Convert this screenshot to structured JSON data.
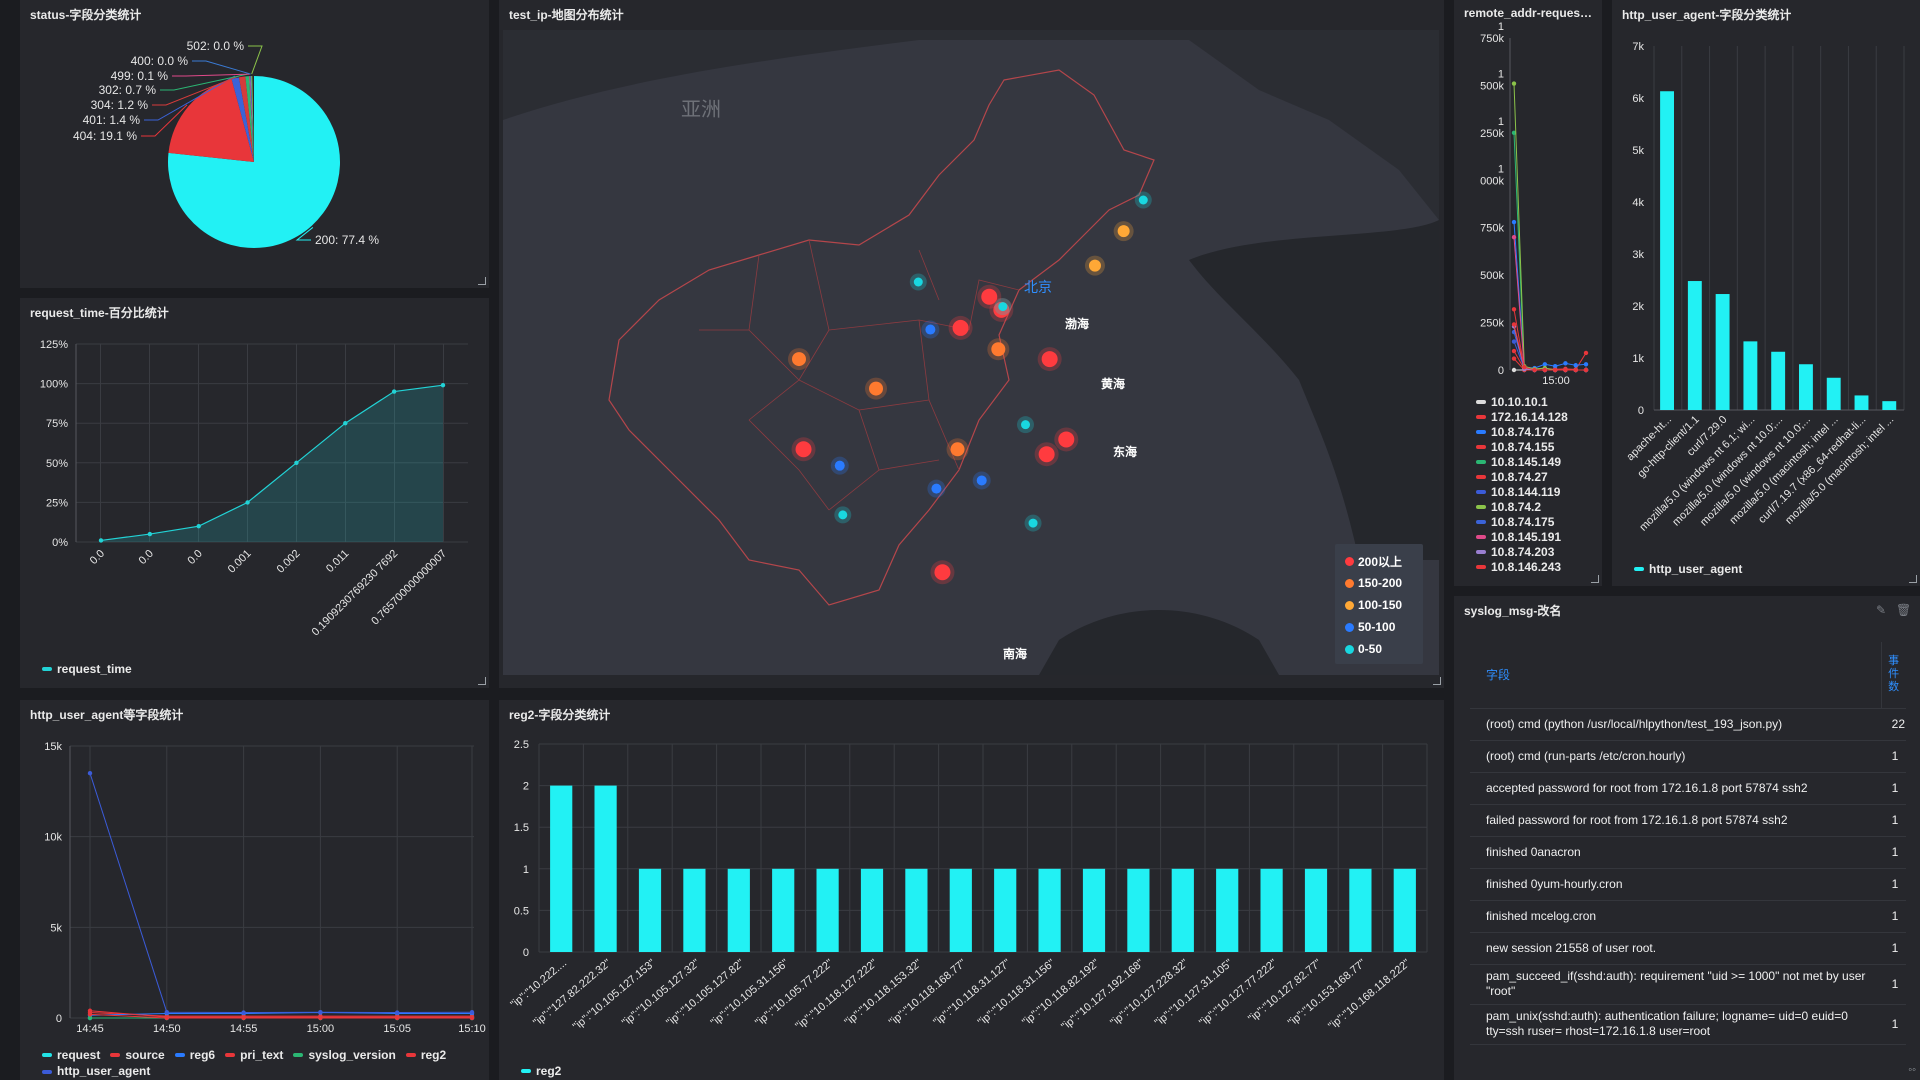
{
  "panels": {
    "status": {
      "title": "status-字段分类统计"
    },
    "request_time": {
      "title": "request_time-百分比统计"
    },
    "map": {
      "title": "test_ip-地图分布统计"
    },
    "remote": {
      "title": "remote_addr-request_l..."
    },
    "agent_bar": {
      "title": "http_user_agent-字段分类统计"
    },
    "multi": {
      "title": "http_user_agent等字段统计"
    },
    "reg2": {
      "title": "reg2-字段分类统计"
    },
    "syslog": {
      "title": "syslog_msg-改名"
    }
  },
  "status_pie": {
    "chart_data": {
      "type": "pie",
      "slices": [
        {
          "label": "200",
          "value": 77.4,
          "text": "200: 77.4 %",
          "color": "#22f1f4"
        },
        {
          "label": "404",
          "value": 19.1,
          "text": "404: 19.1 %",
          "color": "#e8363a"
        },
        {
          "label": "401",
          "value": 1.4,
          "text": "401: 1.4 %",
          "color": "#3b63d8"
        },
        {
          "label": "304",
          "value": 1.2,
          "text": "304: 1.2 %",
          "color": "#d63b3b"
        },
        {
          "label": "302",
          "value": 0.7,
          "text": "302: 0.7 %",
          "color": "#2bb673"
        },
        {
          "label": "499",
          "value": 0.1,
          "text": "499: 0.1 %",
          "color": "#e04a8a"
        },
        {
          "label": "400",
          "value": 0.0,
          "text": "400: 0.0 %",
          "color": "#3a7bd5"
        },
        {
          "label": "502",
          "value": 0.0,
          "text": "502: 0.0 %",
          "color": "#8bc34a"
        }
      ]
    }
  },
  "request_time_chart": {
    "chart_data": {
      "type": "area",
      "x": [
        "0.0",
        "0.0",
        "0.0",
        "0.001",
        "0.002",
        "0.011",
        "0.190923076923 07692",
        "0.765700000000007"
      ],
      "x_labels": [
        "0.0",
        "0.0",
        "0.0",
        "0.001",
        "0.002",
        "0.011",
        "0.1909230769230 7692",
        "0.765700000000007"
      ],
      "series": [
        {
          "name": "request_time",
          "values": [
            1,
            5,
            10,
            25,
            50,
            75,
            95,
            99
          ]
        }
      ],
      "yticks": [
        "0%",
        "25%",
        "50%",
        "75%",
        "100%",
        "125%"
      ],
      "ylim": [
        0,
        125
      ],
      "color": "#22d3d6"
    }
  },
  "map": {
    "labels": {
      "asia": "亚洲",
      "beijing": "北京",
      "bohai": "渤海",
      "huanghai": "黄海",
      "donghai": "东海",
      "nanhai": "南海"
    },
    "legend": [
      {
        "label": "200以上",
        "color": "#ff3b3f"
      },
      {
        "label": "150-200",
        "color": "#ff7a2f"
      },
      {
        "label": "100-150",
        "color": "#ffa836"
      },
      {
        "label": "50-100",
        "color": "#2a7bff"
      },
      {
        "label": "0-50",
        "color": "#19d7e0"
      }
    ],
    "points": [
      {
        "lon": 116.4,
        "lat": 39.9,
        "cat": 0
      },
      {
        "lon": 117.2,
        "lat": 39.1,
        "cat": 0
      },
      {
        "lon": 114.5,
        "lat": 38.0,
        "cat": 0
      },
      {
        "lon": 120.4,
        "lat": 36.1,
        "cat": 0
      },
      {
        "lon": 121.5,
        "lat": 31.2,
        "cat": 0
      },
      {
        "lon": 120.2,
        "lat": 30.3,
        "cat": 0
      },
      {
        "lon": 113.3,
        "lat": 23.1,
        "cat": 0
      },
      {
        "lon": 104.1,
        "lat": 30.6,
        "cat": 0
      },
      {
        "lon": 125.3,
        "lat": 43.9,
        "cat": 2
      },
      {
        "lon": 123.4,
        "lat": 41.8,
        "cat": 2
      },
      {
        "lon": 117.0,
        "lat": 36.7,
        "cat": 1
      },
      {
        "lon": 103.8,
        "lat": 36.1,
        "cat": 1
      },
      {
        "lon": 108.9,
        "lat": 34.3,
        "cat": 1
      },
      {
        "lon": 114.3,
        "lat": 30.6,
        "cat": 1
      },
      {
        "lon": 126.6,
        "lat": 45.8,
        "cat": 4
      },
      {
        "lon": 111.7,
        "lat": 40.8,
        "cat": 4
      },
      {
        "lon": 117.3,
        "lat": 39.3,
        "cat": 4
      },
      {
        "lon": 118.8,
        "lat": 32.1,
        "cat": 4
      },
      {
        "lon": 106.7,
        "lat": 26.6,
        "cat": 4
      },
      {
        "lon": 119.3,
        "lat": 26.1,
        "cat": 4
      },
      {
        "lon": 112.5,
        "lat": 37.9,
        "cat": 3
      },
      {
        "lon": 106.5,
        "lat": 29.6,
        "cat": 3
      },
      {
        "lon": 112.9,
        "lat": 28.2,
        "cat": 3
      },
      {
        "lon": 115.9,
        "lat": 28.7,
        "cat": 3
      }
    ]
  },
  "remote_chart": {
    "chart_data": {
      "type": "line",
      "ytick_labels": [
        [
          "0"
        ],
        [
          "250k"
        ],
        [
          "500k"
        ],
        [
          "750k"
        ],
        [
          "1",
          "000k"
        ],
        [
          "1",
          "250k"
        ],
        [
          "1",
          "500k"
        ],
        [
          "1",
          "750k"
        ]
      ],
      "ylim": [
        0,
        1750000
      ],
      "xtick": "15:00",
      "series": [
        {
          "name": "10.10.10.1",
          "color": "#dcdcdc",
          "values": [
            0,
            0,
            0,
            0,
            0,
            0,
            0,
            0
          ]
        },
        {
          "name": "172.16.14.128",
          "color": "#e8363a",
          "values": [
            320000,
            10000,
            5000,
            8000,
            4000,
            6000,
            3000,
            90000
          ]
        },
        {
          "name": "10.8.74.176",
          "color": "#2a7bff",
          "values": [
            780000,
            15000,
            10000,
            30000,
            20000,
            35000,
            25000,
            30000
          ]
        },
        {
          "name": "10.8.74.155",
          "color": "#e8363a",
          "values": [
            100000,
            5000,
            0,
            0,
            0,
            0,
            0,
            0
          ]
        },
        {
          "name": "10.8.145.149",
          "color": "#2bb673",
          "values": [
            1250000,
            5000,
            0,
            0,
            0,
            0,
            0,
            0
          ]
        },
        {
          "name": "10.8.74.27",
          "color": "#e8363a",
          "values": [
            60000,
            0,
            0,
            0,
            0,
            0,
            0,
            0
          ]
        },
        {
          "name": "10.8.144.119",
          "color": "#3b5bd8",
          "values": [
            150000,
            10000,
            0,
            0,
            0,
            0,
            0,
            0
          ]
        },
        {
          "name": "10.8.74.2",
          "color": "#8bc34a",
          "values": [
            1510000,
            20000,
            5000,
            10000,
            0,
            0,
            0,
            0
          ]
        },
        {
          "name": "10.8.74.175",
          "color": "#3b63d8",
          "values": [
            200000,
            10000,
            0,
            0,
            0,
            0,
            0,
            0
          ]
        },
        {
          "name": "10.8.145.191",
          "color": "#e04a8a",
          "values": [
            700000,
            8000,
            0,
            0,
            0,
            0,
            0,
            0
          ]
        },
        {
          "name": "10.8.74.203",
          "color": "#9a7fd1",
          "values": [
            230000,
            5000,
            0,
            0,
            0,
            0,
            0,
            0
          ]
        },
        {
          "name": "10.8.146.243",
          "color": "#e8363a",
          "values": [
            240000,
            15000,
            0,
            0,
            0,
            0,
            0,
            0
          ]
        }
      ]
    }
  },
  "agent_bar_chart": {
    "chart_data": {
      "type": "bar",
      "categories": [
        "apache-ht...",
        "go-http-client/1.1",
        "curl/7.29.0",
        "mozilla/5.0 (windows nt 6.1; wi...",
        "mozilla/5.0 (windows nt 10.0;...",
        "mozilla/5.0 (windows nt 10.0;...",
        "mozilla/5.0 (macintosh; intel ...",
        "curl/7.19.7 (x86_64-redhat-li...",
        "mozilla/5.0 (macintosh; intel ..."
      ],
      "values": [
        6130,
        2480,
        2230,
        1320,
        1120,
        880,
        620,
        280,
        170
      ],
      "yticks": [
        "0",
        "1k",
        "2k",
        "3k",
        "4k",
        "5k",
        "6k",
        "7k"
      ],
      "ylim": [
        0,
        7000
      ],
      "series_name": "http_user_agent",
      "color": "#22f1f4"
    }
  },
  "multi_chart": {
    "chart_data": {
      "type": "line",
      "x": [
        "14:45",
        "14:50",
        "14:55",
        "15:00",
        "15:05",
        "15:10"
      ],
      "yticks": [
        "0",
        "5k",
        "10k",
        "15k"
      ],
      "ylim": [
        0,
        15000
      ],
      "series": [
        {
          "name": "request",
          "color": "#22e3e6",
          "values": [
            0,
            0,
            0,
            0,
            0,
            0
          ]
        },
        {
          "name": "source",
          "color": "#e8363a",
          "values": [
            300,
            100,
            100,
            100,
            100,
            100
          ]
        },
        {
          "name": "reg6",
          "color": "#2a7bff",
          "values": [
            150,
            250,
            250,
            300,
            250,
            250
          ]
        },
        {
          "name": "pri_text",
          "color": "#e8363a",
          "values": [
            400,
            50,
            50,
            50,
            50,
            50
          ]
        },
        {
          "name": "syslog_version",
          "color": "#2bb673",
          "values": [
            0,
            0,
            0,
            0,
            0,
            0
          ]
        },
        {
          "name": "reg2",
          "color": "#e8363a",
          "values": [
            200,
            0,
            0,
            0,
            0,
            0
          ]
        },
        {
          "name": "http_user_agent",
          "color": "#3b5bd8",
          "values": [
            13500,
            320,
            300,
            320,
            300,
            320
          ]
        }
      ]
    }
  },
  "reg2_chart": {
    "chart_data": {
      "type": "bar",
      "categories": [
        "\"ip\":\"10.222....",
        "\"ip\":\"127.82.222.32\"",
        "\"ip\":\"10.105.127.153\"",
        "\"ip\":\"10.105.127.32\"",
        "\"ip\":\"10.105.127.82\"",
        "\"ip\":\"10.105.31.156\"",
        "\"ip\":\"10.105.77.222\"",
        "\"ip\":\"10.118.127.222\"",
        "\"ip\":\"10.118.153.32\"",
        "\"ip\":\"10.118.168.77\"",
        "\"ip\":\"10.118.31.127\"",
        "\"ip\":\"10.118.31.156\"",
        "\"ip\":\"10.118.82.192\"",
        "\"ip\":\"10.127.192.168\"",
        "\"ip\":\"10.127.228.32\"",
        "\"ip\":\"10.127.31.105\"",
        "\"ip\":\"10.127.77.222\"",
        "\"ip\":\"10.127.82.77\"",
        "\"ip\":\"10.153.168.77\"",
        "\"ip\":\"10.168.118.222\""
      ],
      "values": [
        2,
        2,
        1,
        1,
        1,
        1,
        1,
        1,
        1,
        1,
        1,
        1,
        1,
        1,
        1,
        1,
        1,
        1,
        1,
        1
      ],
      "yticks": [
        "0",
        "0.5",
        "1",
        "1.5",
        "2",
        "2.5"
      ],
      "ylim": [
        0,
        2.5
      ],
      "series_name": "reg2",
      "color": "#22f1f4"
    }
  },
  "syslog_table": {
    "headers": {
      "field": "字段",
      "count": "事件数"
    },
    "rows": [
      {
        "field": "(root) cmd (python /usr/local/hlpython/test_193_json.py)",
        "count": "22"
      },
      {
        "field": "(root) cmd (run-parts /etc/cron.hourly)",
        "count": "1"
      },
      {
        "field": "accepted password for root from 172.16.1.8 port 57874 ssh2",
        "count": "1"
      },
      {
        "field": "failed password for root from 172.16.1.8 port 57874 ssh2",
        "count": "1"
      },
      {
        "field": "finished 0anacron",
        "count": "1"
      },
      {
        "field": "finished 0yum-hourly.cron",
        "count": "1"
      },
      {
        "field": "finished mcelog.cron",
        "count": "1"
      },
      {
        "field": "new session 21558 of user root.",
        "count": "1"
      },
      {
        "field": "pam_succeed_if(sshd:auth): requirement \"uid >= 1000\" not met by user \"root\"",
        "count": "1"
      },
      {
        "field": "pam_unix(sshd:auth): authentication failure; logname= uid=0 euid=0 tty=ssh ruser= rhost=172.16.1.8 user=root",
        "count": "1"
      }
    ]
  }
}
